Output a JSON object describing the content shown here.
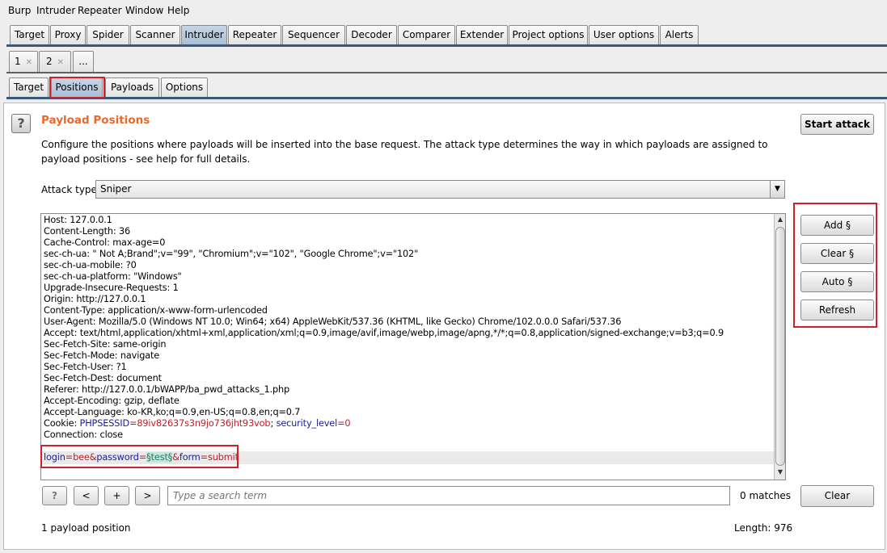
{
  "menu": [
    "Burp",
    "Intruder",
    "Repeater",
    "Window",
    "Help"
  ],
  "main_tabs": [
    "Target",
    "Proxy",
    "Spider",
    "Scanner",
    "Intruder",
    "Repeater",
    "Sequencer",
    "Decoder",
    "Comparer",
    "Extender",
    "Project options",
    "User options",
    "Alerts"
  ],
  "attack_tabs": {
    "tab1": "1",
    "tab2": "2",
    "add": "..."
  },
  "sub_tabs": [
    "Target",
    "Positions",
    "Payloads",
    "Options"
  ],
  "section": {
    "title": "Payload Positions",
    "description": "Configure the positions where payloads will be inserted into the base request. The attack type determines the way in which payloads are assigned to payload positions - see help for full details."
  },
  "attack_type": {
    "label": "Attack type:",
    "value": "Sniper"
  },
  "buttons": {
    "start_attack": "Start attack",
    "add": "Add §",
    "clear_marks": "Clear §",
    "auto": "Auto §",
    "refresh": "Refresh",
    "clear": "Clear"
  },
  "request_lines": [
    "Host: 127.0.0.1",
    "Content-Length: 36",
    "Cache-Control: max-age=0",
    "sec-ch-ua: \" Not A;Brand\";v=\"99\", \"Chromium\";v=\"102\", \"Google Chrome\";v=\"102\"",
    "sec-ch-ua-mobile: ?0",
    "sec-ch-ua-platform: \"Windows\"",
    "Upgrade-Insecure-Requests: 1",
    "Origin: http://127.0.0.1",
    "Content-Type: application/x-www-form-urlencoded",
    "User-Agent: Mozilla/5.0 (Windows NT 10.0; Win64; x64) AppleWebKit/537.36 (KHTML, like Gecko) Chrome/102.0.0.0 Safari/537.36",
    "Accept: text/html,application/xhtml+xml,application/xml;q=0.9,image/avif,image/webp,image/apng,*/*;q=0.8,application/signed-exchange;v=b3;q=0.9",
    "Sec-Fetch-Site: same-origin",
    "Sec-Fetch-Mode: navigate",
    "Sec-Fetch-User: ?1",
    "Sec-Fetch-Dest: document",
    "Referer: http://127.0.0.1/bWAPP/ba_pwd_attacks_1.php",
    "Accept-Encoding: gzip, deflate",
    "Accept-Language: ko-KR,ko;q=0.9,en-US;q=0.8,en;q=0.7"
  ],
  "cookie_line": {
    "prefix": "Cookie: ",
    "n1": "PHPSESSID",
    "v1": "=89iv82637s3n9jo736jht93vob",
    "sep": "; ",
    "n2": "security_level",
    "v2": "=0"
  },
  "connection_line": "Connection: close",
  "body_line": {
    "p1": "login",
    "v1": "=bee&",
    "p2": "password",
    "v2": "=",
    "marker": "§test§",
    "amp": "&",
    "p3": "form",
    "v3": "=submit"
  },
  "search": {
    "placeholder": "Type a search term",
    "matches": "0 matches",
    "prev": "<",
    "add": "+",
    "next": ">",
    "help": "?"
  },
  "status": {
    "positions": "1 payload position",
    "length": "Length: 976"
  },
  "colors": {
    "title": "#e8692b",
    "selected_tab": "#b5c8dc",
    "highlight": "#d0202a"
  }
}
